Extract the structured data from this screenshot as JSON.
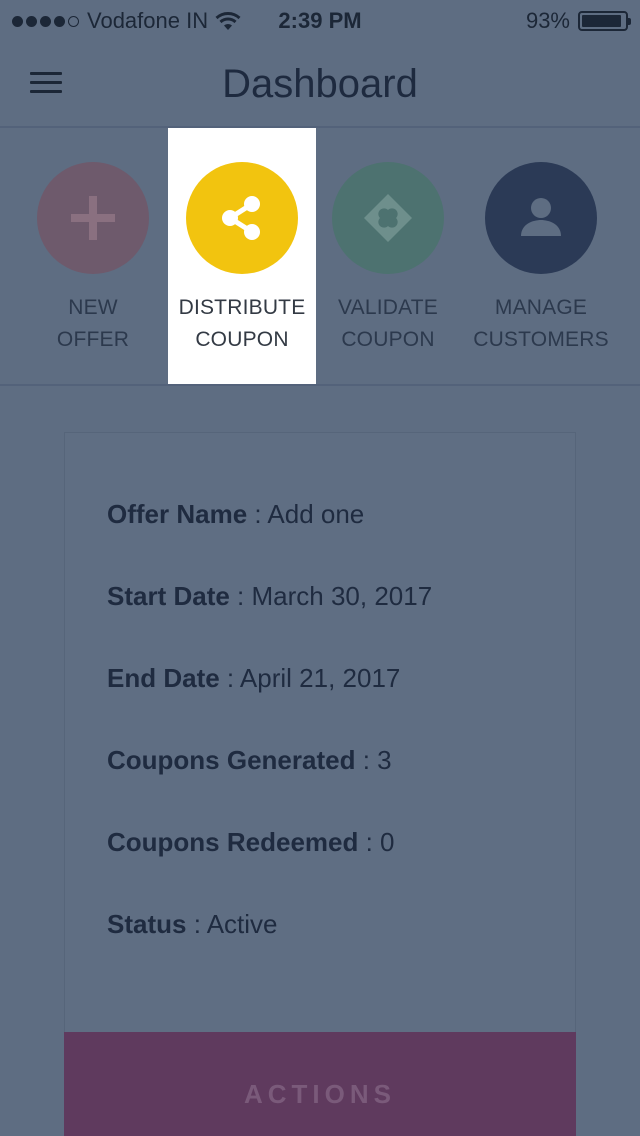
{
  "status_bar": {
    "carrier": "Vodafone IN",
    "time": "2:39 PM",
    "battery": "93%",
    "battery_level": 0.93,
    "signal_bars": 4
  },
  "header": {
    "title": "Dashboard",
    "menu_icon": "hamburger-icon"
  },
  "quick_actions": [
    {
      "line1": "NEW",
      "line2": "OFFER",
      "icon": "plus-icon",
      "color": "#6e5a6c"
    },
    {
      "line1": "DISTRIBUTE",
      "line2": "COUPON",
      "icon": "share-icon",
      "color": "#f2c40f",
      "highlighted": true
    },
    {
      "line1": "VALIDATE",
      "line2": "COUPON",
      "icon": "ticket-icon",
      "color": "#4d7270"
    },
    {
      "line1": "MANAGE",
      "line2": "CUSTOMERS",
      "icon": "person-icon",
      "color": "#2b3a56"
    }
  ],
  "offer": {
    "name_label": "Offer Name",
    "name_value": " : Add one",
    "start_label": "Start Date",
    "start_value": " : March 30, 2017",
    "end_label": "End Date",
    "end_value": " : April 21, 2017",
    "generated_label": "Coupons Generated",
    "generated_value": " : 3",
    "redeemed_label": "Coupons Redeemed",
    "redeemed_value": " : 0",
    "status_label": "Status",
    "status_value": " : Active"
  },
  "actions_button": {
    "label": "ACTIONS"
  },
  "colors": {
    "overlay_background": "#5e6d82",
    "actions_button": "#5f3a5e",
    "accent_yellow": "#f2c40f"
  }
}
